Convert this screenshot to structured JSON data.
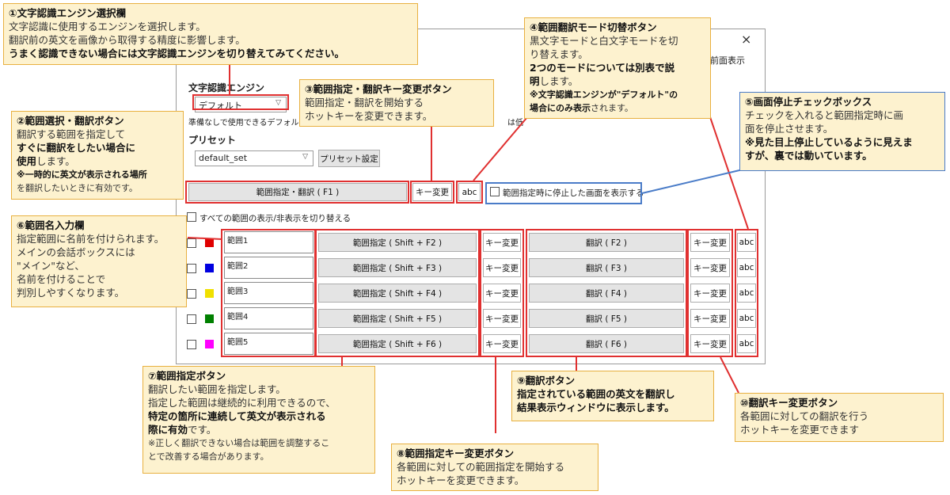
{
  "window": {
    "close_glyph": "×",
    "top_right_text": "最前面表示"
  },
  "engine": {
    "label": "文字認識エンジン",
    "selected": "デフォルト",
    "hint_start": "準備なしで使用できるデフォル",
    "hint_end": "は低"
  },
  "preset": {
    "label": "プリセット",
    "selected": "default_set",
    "settings_button": "プリセット設定"
  },
  "main_row": {
    "select_translate_button": "範囲指定・翻訳 ( F1 )",
    "key_change_button": "キー変更",
    "abc_button": "abc",
    "freeze_label": "範囲指定時に停止した画面を表示する"
  },
  "toggle_all_label": "すべての範囲の表示/非表示を切り替える",
  "ranges": [
    {
      "name": "範囲1",
      "color": "#e00000",
      "range_button": "範囲指定 ( Shift + F2 )",
      "range_key": "キー変更",
      "translate_button": "翻訳 ( F2 )",
      "translate_key": "キー変更",
      "abc": "abc"
    },
    {
      "name": "範囲2",
      "color": "#0000e0",
      "range_button": "範囲指定 ( Shift + F3 )",
      "range_key": "キー変更",
      "translate_button": "翻訳 ( F3 )",
      "translate_key": "キー変更",
      "abc": "abc"
    },
    {
      "name": "範囲3",
      "color": "#f0e000",
      "range_button": "範囲指定 ( Shift + F4 )",
      "range_key": "キー変更",
      "translate_button": "翻訳 ( F4 )",
      "translate_key": "キー変更",
      "abc": "abc"
    },
    {
      "name": "範囲4",
      "color": "#008000",
      "range_button": "範囲指定 ( Shift + F5 )",
      "range_key": "キー変更",
      "translate_button": "翻訳 ( F5 )",
      "translate_key": "キー変更",
      "abc": "abc"
    },
    {
      "name": "範囲5",
      "color": "#ff00ff",
      "range_button": "範囲指定 ( Shift + F6 )",
      "range_key": "キー変更",
      "translate_button": "翻訳 ( F6 )",
      "translate_key": "キー変更",
      "abc": "abc"
    }
  ],
  "notes": {
    "n1": {
      "title": "①文字認識エンジン選択欄",
      "l1": "文字認識に使用するエンジンを選択します。",
      "l2": "翻訳前の英文を画像から取得する精度に影響します。",
      "l3": "うまく認識できない場合には文字認識エンジンを切り替えてみてください。"
    },
    "n2": {
      "title": "②範囲選択・翻訳ボタン",
      "l1": "翻訳する範囲を指定して",
      "l2": "すぐに翻訳をしたい場合に",
      "l3a": "使用",
      "l3b": "します。",
      "l4": "※一時的に英文が表示される場所",
      "l5": "を翻訳したいときに有効です。"
    },
    "n3": {
      "title": "③範囲指定・翻訳キー変更ボタン",
      "l1": "範囲指定・翻訳を開始する",
      "l2": "ホットキーを変更できます。"
    },
    "n4": {
      "title": "④範囲翻訳モード切替ボタン",
      "l1": "黒文字モードと白文字モードを切",
      "l2": "り替えます。",
      "l3": "2つのモードについては別表で説",
      "l4a": "明",
      "l4b": "します。",
      "l5": "※文字認識エンジンが\"デフォルト\"の",
      "l6a": "場合にのみ表示",
      "l6b": "されます。"
    },
    "n5": {
      "title": "⑤画面停止チェックボックス",
      "l1": "チェックを入れると範囲指定時に画",
      "l2": "面を停止させます。",
      "l3": "※見た目上停止しているように見えま",
      "l4": "すが、裏では動いています。"
    },
    "n6": {
      "title": "⑥範囲名入力欄",
      "l1": "指定範囲に名前を付けられます。",
      "l2": "メインの会話ボックスには",
      "l3": "\"メイン\"など、",
      "l4": "名前を付けることで",
      "l5": "判別しやすくなります。"
    },
    "n7": {
      "title": "⑦範囲指定ボタン",
      "l1": "翻訳したい範囲を指定します。",
      "l2": "指定した範囲は継続的に利用できるので、",
      "l3": "特定の箇所に連続して英文が表示される",
      "l4a": "際に有効",
      "l4b": "です。",
      "l5": "※正しく翻訳できない場合は範囲を調整するこ",
      "l6": "とで改善する場合があります。"
    },
    "n8": {
      "title": "⑧範囲指定キー変更ボタン",
      "l1": "各範囲に対しての範囲指定を開始する",
      "l2": "ホットキーを変更できます。"
    },
    "n9": {
      "title": "⑨翻訳ボタン",
      "l1": "指定されている範囲の英文を翻訳し",
      "l2": "結果表示ウィンドウに表示します。"
    },
    "n10": {
      "title": "⑩翻訳キー変更ボタン",
      "l1": "各範囲に対しての翻訳を行う",
      "l2": "ホットキーを変更できます"
    }
  }
}
